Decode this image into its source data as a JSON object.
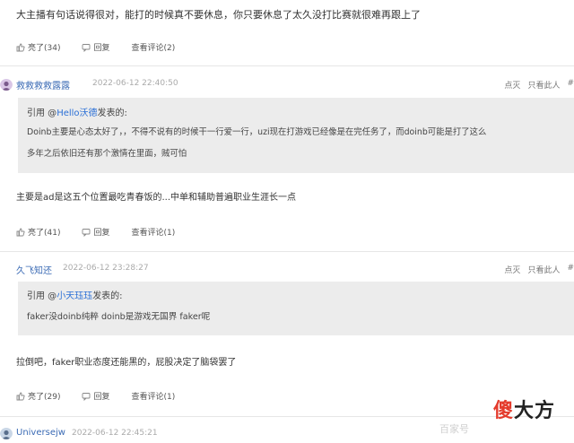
{
  "comments": [
    {
      "body": "大主播有句话说得很对，能打的时候真不要休息，你只要休息了太久没打比赛就很难再跟上了",
      "actions": {
        "like": "亮了(34)",
        "reply": "回复",
        "view": "查看评论(2)"
      }
    },
    {
      "user": "救救救救露露",
      "time": "2022-06-12 22:40:50",
      "tools": [
        "点灭",
        "只看此人",
        "#"
      ],
      "quote": {
        "prefix": "引用 @",
        "mention": "Hello沃德",
        "suffix": "发表的:",
        "lines": [
          "Doinb主要是心态太好了，，不得不说有的时候干一行爱一行，uzi现在打游戏已经像是在完任务了，而doinb可能是打了这么",
          "多年之后依旧还有那个激情在里面，贼可怕"
        ]
      },
      "body": "主要是ad是这五个位置最吃青春饭的...中单和辅助普遍职业生涯长一点",
      "actions": {
        "like": "亮了(41)",
        "reply": "回复",
        "view": "查看评论(1)"
      }
    },
    {
      "user": "久飞知还",
      "time": "2022-06-12 23:28:27",
      "tools": [
        "点灭",
        "只看此人",
        "#"
      ],
      "quote": {
        "prefix": "引用 @",
        "mention": "小天珏珏",
        "suffix": "发表的:",
        "lines": [
          "faker没doinb纯粹 doinb是游戏无国界 faker呢"
        ]
      },
      "body": "拉倒吧，faker职业态度还能黑的，屁股决定了脑袋罢了",
      "actions": {
        "like": "亮了(29)",
        "reply": "回复",
        "view": "查看评论(1)"
      }
    },
    {
      "user": "Universejw",
      "time": "2022-06-12 22:45:21"
    }
  ],
  "watermark": {
    "left": "百家号",
    "logo_red": "傻",
    "logo_black": "大方"
  }
}
